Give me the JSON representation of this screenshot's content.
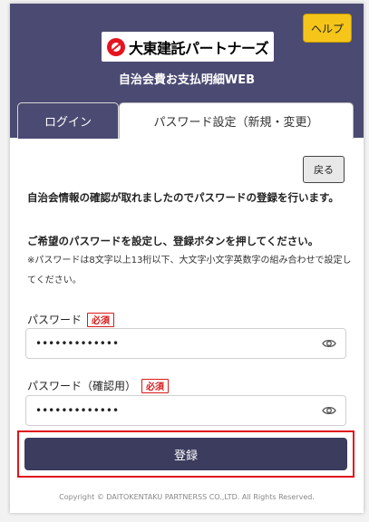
{
  "header": {
    "help_label": "ヘルプ",
    "logo_text": "大東建託パートナーズ",
    "subtitle": "自治会費お支払明細WEB",
    "background_color": "#4a4a72"
  },
  "tabs": [
    {
      "label": "ログイン",
      "active": false
    },
    {
      "label": "パスワード設定（新規・変更）",
      "active": true
    }
  ],
  "back_label": "戻る",
  "messages": {
    "line1": "自治会情報の確認が取れましたのでパスワードの登録を行います。",
    "line2": "ご希望のパスワードを設定し、登録ボタンを押してください。",
    "note": "※パスワードは8文字以上13桁以下、大文字小文字英数字の組み合わせで設定してください。"
  },
  "fields": {
    "password": {
      "label": "パスワード",
      "required": "必須",
      "value": "•••••••••••••"
    },
    "password_confirm": {
      "label": "パスワード（確認用）",
      "required": "必須",
      "value": "•••••••••••••"
    }
  },
  "register_label": "登録",
  "copyright": "Copyright © DAITOKENTAKU PARTNERSS CO.,LTD. All Rights Reserved.",
  "icons": {
    "eye": "eye-icon",
    "logo": "daito-logo-mark-icon"
  },
  "colors": {
    "accent": "#f5c51a",
    "required": "#d91a1a",
    "button": "#3c3c5e",
    "highlight": "#e0151b"
  }
}
